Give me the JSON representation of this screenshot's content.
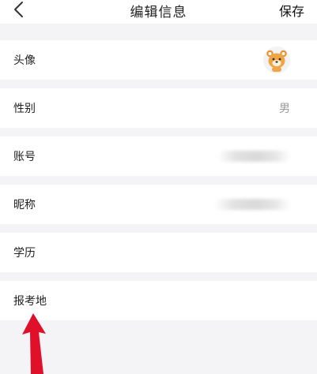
{
  "header": {
    "title": "编辑信息",
    "save_label": "保存"
  },
  "rows": [
    {
      "label": "头像",
      "value": ""
    },
    {
      "label": "性别",
      "value": "男"
    },
    {
      "label": "账号",
      "value": ""
    },
    {
      "label": "昵称",
      "value": ""
    },
    {
      "label": "学历",
      "value": ""
    },
    {
      "label": "报考地",
      "value": ""
    }
  ],
  "colors": {
    "background": "#f4f4f6",
    "row_background": "#ffffff",
    "arrow": "#e0102a",
    "avatar_bear": "#f0a545"
  },
  "annotation": {
    "type": "red-arrow",
    "points_to": "报考地"
  }
}
